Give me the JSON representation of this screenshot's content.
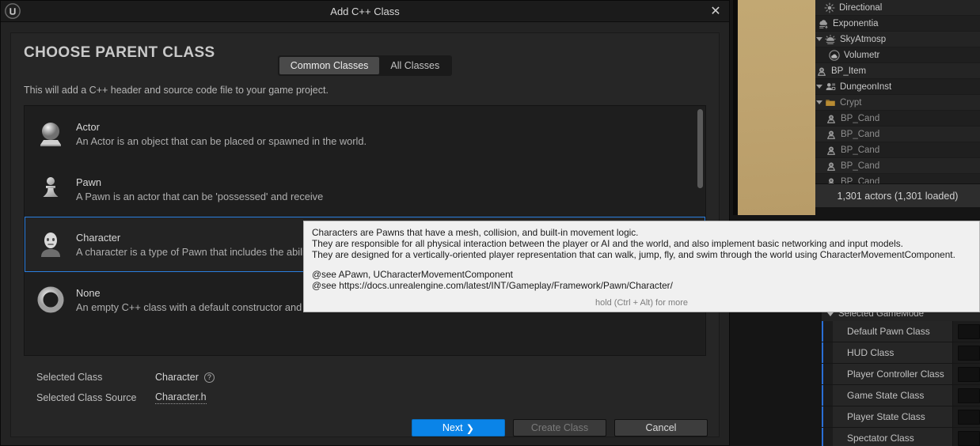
{
  "window": {
    "title": "Add C++ Class",
    "logo_icon": "unreal-engine-logo-icon",
    "close_icon": "close-icon"
  },
  "dialog": {
    "section_title": "CHOOSE PARENT CLASS",
    "tabs": [
      {
        "label": "Common Classes",
        "active": true
      },
      {
        "label": "All Classes",
        "active": false
      }
    ],
    "subtext": "This will add a C++ header and source code file to your game project.",
    "classes": [
      {
        "name": "None",
        "description": "An empty C++ class with a default constructor and destructor.",
        "icon": "ring-icon",
        "selected": false
      },
      {
        "name": "Character",
        "description": "A character is a type of Pawn that includes the ability to walk around.",
        "icon": "character-bust-icon",
        "selected": true
      },
      {
        "name": "Pawn",
        "description": "A Pawn is an actor that can be 'possessed' and receive",
        "icon": "chess-pawn-icon",
        "selected": false
      },
      {
        "name": "Actor",
        "description": "An Actor is an object that can be placed or spawned in the world.",
        "icon": "sphere-on-base-icon",
        "selected": false
      }
    ],
    "footer": {
      "selected_class_label": "Selected Class",
      "selected_class_value": "Character",
      "help_icon": "question-mark-icon",
      "selected_class_source_label": "Selected Class Source",
      "selected_class_source_value": "Character.h"
    },
    "buttons": {
      "next": "Next",
      "next_arrow": "❯",
      "create_class": "Create Class",
      "cancel": "Cancel"
    }
  },
  "tooltip": {
    "lines": [
      "Characters are Pawns that have a mesh, collision, and built-in movement logic.",
      "They are responsible for all physical interaction between the player or AI and the world, and also implement basic networking and input models.",
      "They are designed for a vertically-oriented player representation that can walk, jump, fly, and swim through the world using CharacterMovementComponent."
    ],
    "see_lines": [
      "@see APawn, UCharacterMovementComponent",
      "@see https://docs.unrealengine.com/latest/INT/Gameplay/Framework/Pawn/Character/"
    ],
    "hint": "hold (Ctrl + Alt) for more"
  },
  "outliner": {
    "rows": [
      {
        "label": "Directional",
        "icon": "directional-light-icon",
        "indent": 110,
        "expand": false,
        "dim": false
      },
      {
        "label": "Exponentia",
        "icon": "fog-icon",
        "indent": 102,
        "expand": false,
        "dim": false
      },
      {
        "label": "SkyAtmosp",
        "icon": "sky-atmosphere-icon",
        "indent": 96,
        "expand": true,
        "dim": false
      },
      {
        "label": "Volumetr",
        "icon": "volumetric-cloud-icon",
        "indent": 116,
        "expand": false,
        "dim": false
      },
      {
        "label": "BP_Item",
        "icon": "blueprint-actor-icon",
        "indent": 88,
        "expand": false,
        "dim": false
      },
      {
        "label": "DungeonInst",
        "icon": "dungeon-instance-icon",
        "indent": 76,
        "expand": true,
        "dim": false
      },
      {
        "label": "Crypt",
        "icon": "folder-icon",
        "indent": 88,
        "expand": true,
        "dim": true
      },
      {
        "label": "BP_Cand",
        "icon": "blueprint-actor-icon",
        "indent": 112,
        "expand": false,
        "dim": true
      },
      {
        "label": "BP_Cand",
        "icon": "blueprint-actor-icon",
        "indent": 112,
        "expand": false,
        "dim": true
      },
      {
        "label": "BP_Cand",
        "icon": "blueprint-actor-icon",
        "indent": 112,
        "expand": false,
        "dim": true
      },
      {
        "label": "BP_Cand",
        "icon": "blueprint-actor-icon",
        "indent": 112,
        "expand": false,
        "dim": true
      },
      {
        "label": "BP_Cand",
        "icon": "blueprint-actor-icon",
        "indent": 112,
        "expand": false,
        "dim": true
      }
    ],
    "status": "1,301 actors (1,301 loaded)"
  },
  "details": {
    "header": "Selected GameMode",
    "rows": [
      {
        "label": "Default Pawn Class"
      },
      {
        "label": "HUD Class"
      },
      {
        "label": "Player Controller Class"
      },
      {
        "label": "Game State Class"
      },
      {
        "label": "Player State Class"
      },
      {
        "label": "Spectator Class"
      }
    ]
  },
  "colors": {
    "accent_blue": "#0a84e8",
    "selection_border": "#2a7fe0",
    "dialog_bg": "#232323",
    "tooltip_bg": "#f0f0f0",
    "viewport_tan": "#c2a873"
  }
}
